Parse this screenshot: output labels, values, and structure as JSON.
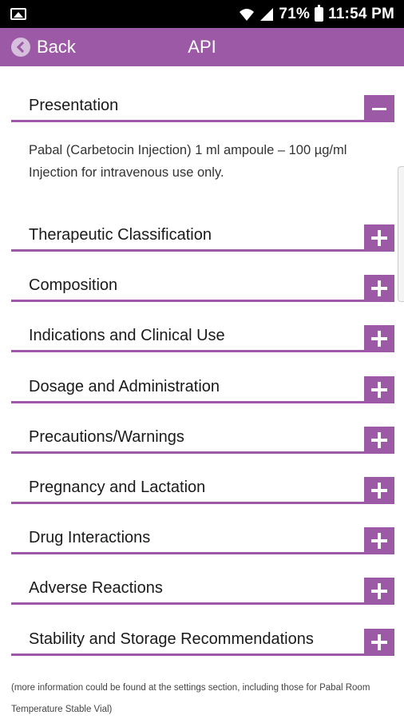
{
  "status_bar": {
    "battery": "71%",
    "time": "11:54 PM",
    "icons": [
      "image-notification-icon",
      "wifi-icon",
      "signal-icon",
      "battery-icon"
    ]
  },
  "header": {
    "back_label": "Back",
    "title": "API"
  },
  "presentation": {
    "title": "Presentation",
    "text": "Pabal (Carbetocin Injection) 1 ml ampoule – 100 µg/ml Injection for intravenous use only."
  },
  "sections": [
    {
      "label": "Therapeutic Classification"
    },
    {
      "label": "Composition"
    },
    {
      "label": "Indications and Clinical Use"
    },
    {
      "label": "Dosage and Administration"
    },
    {
      "label": "Precautions/Warnings"
    },
    {
      "label": "Pregnancy and Lactation"
    },
    {
      "label": "Drug Interactions"
    },
    {
      "label": "Adverse Reactions"
    },
    {
      "label": "Stability and Storage Recommendations"
    }
  ],
  "footer_note": "(more information could be found at the settings section, including those for Pabal Room Temperature Stable Vial)",
  "colors": {
    "accent": "#9b59a6",
    "status_bar": "#000000",
    "background": "#ffffff"
  }
}
